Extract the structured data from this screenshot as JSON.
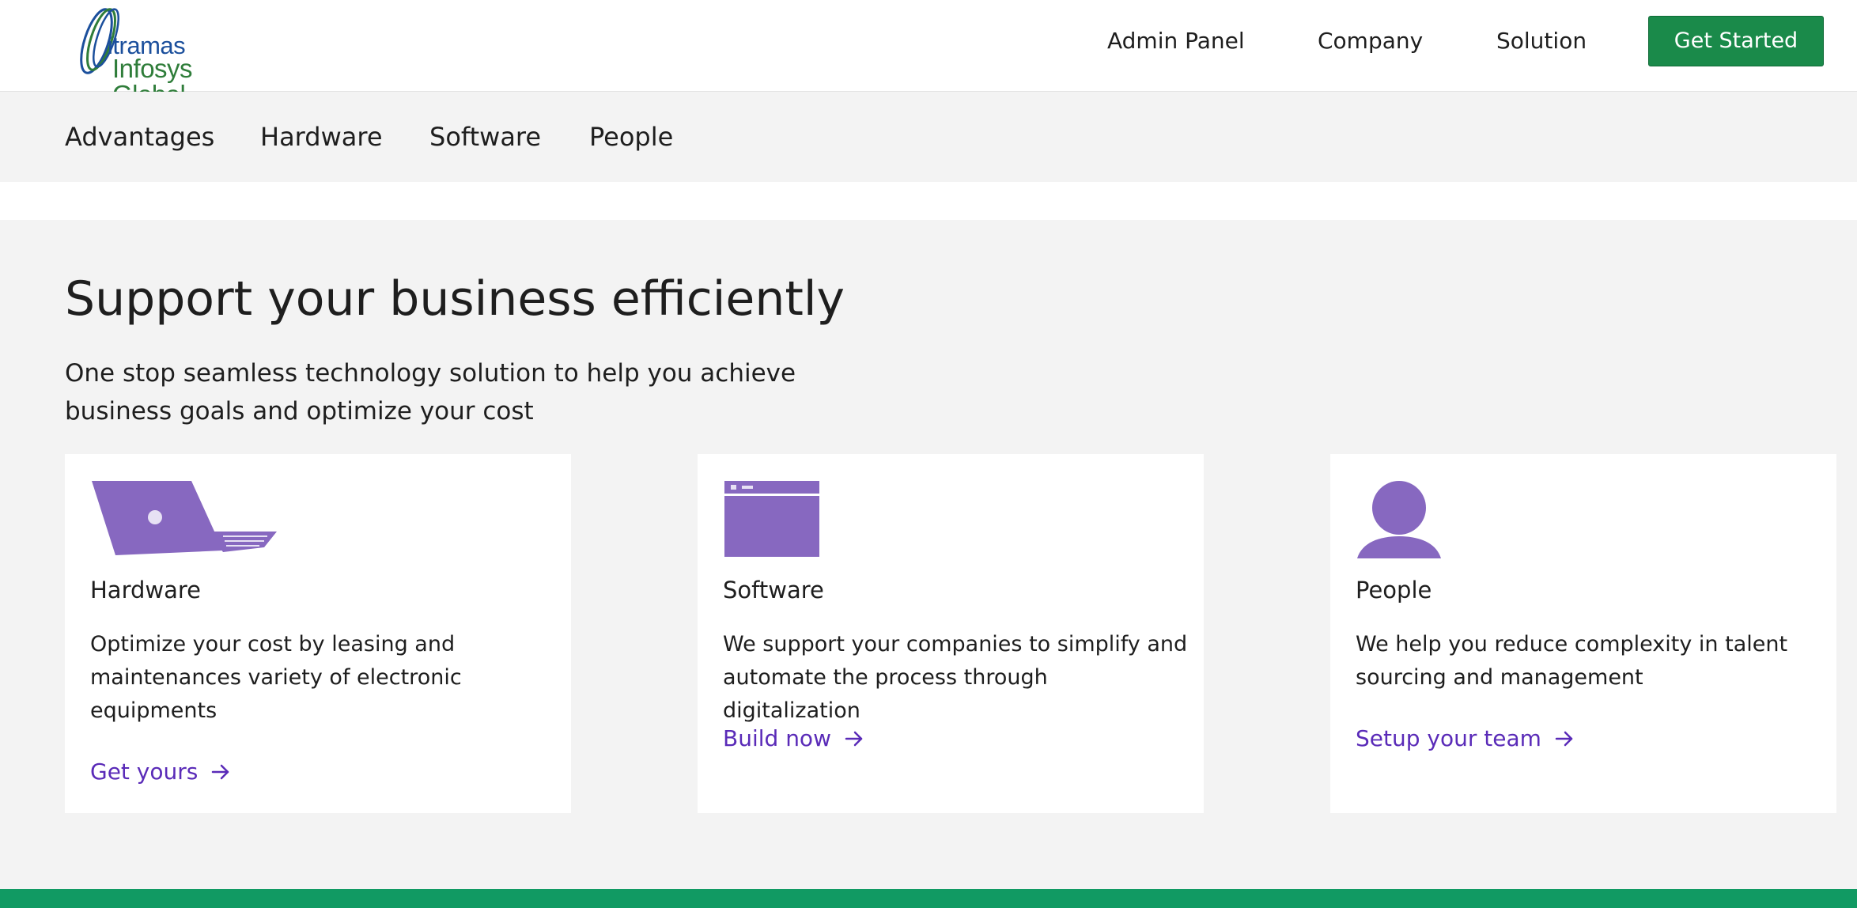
{
  "brand": {
    "line1": "itramas",
    "line2": "Infosys Global"
  },
  "topnav": {
    "items": [
      {
        "label": "Admin Panel"
      },
      {
        "label": "Company"
      },
      {
        "label": "Solution"
      }
    ],
    "cta_label": "Get Started"
  },
  "subnav": {
    "items": [
      {
        "label": "Advantages"
      },
      {
        "label": "Hardware"
      },
      {
        "label": "Software"
      },
      {
        "label": "People"
      }
    ]
  },
  "hero": {
    "title": "Support your business efficiently",
    "subtitle": "One stop seamless technology solution to help you achieve business goals and optimize your cost"
  },
  "cards": [
    {
      "icon": "laptop-icon",
      "title": "Hardware",
      "description": "Optimize your cost by leasing and maintenances variety of electronic equipments",
      "link": "Get yours"
    },
    {
      "icon": "browser-window-icon",
      "title": "Software",
      "description": "We support your companies to simplify and automate the process through digitalization",
      "link": "Build now"
    },
    {
      "icon": "person-icon",
      "title": "People",
      "description": "We help you reduce complexity in talent sourcing and management",
      "link": "Setup your team"
    }
  ],
  "colors": {
    "brand_blue": "#1b4f9c",
    "brand_green": "#2f7d3a",
    "cta_green": "#1a8a4a",
    "link_purple": "#5a2bb8",
    "icon_purple": "#8768c0",
    "section_bg": "#f3f3f3",
    "footer_green": "#119a63"
  }
}
